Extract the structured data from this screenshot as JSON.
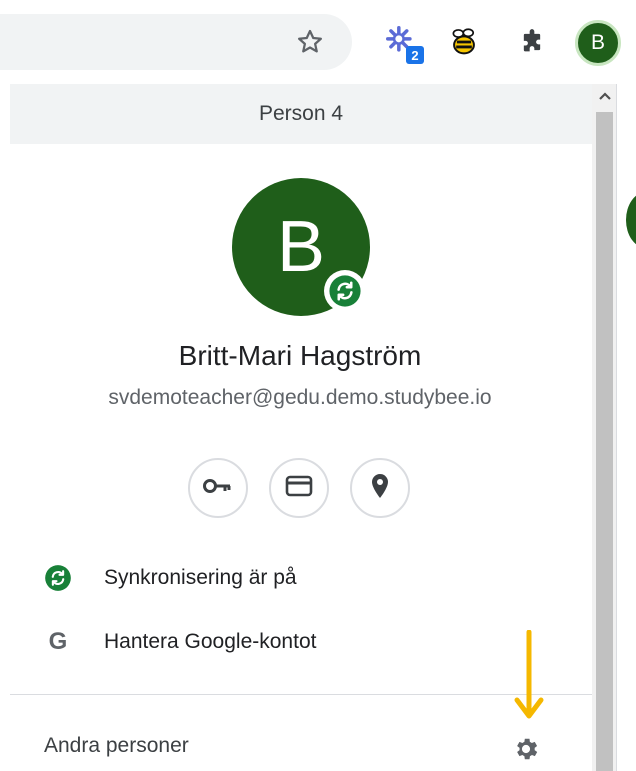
{
  "toolbar": {
    "extensions": [
      {
        "name": "puzzle-sparkle-extension",
        "badge": "2"
      },
      {
        "name": "bee-extension"
      },
      {
        "name": "extensions-puzzle"
      }
    ],
    "profile_initial": "B"
  },
  "profile_menu": {
    "header": "Person 4",
    "avatar_initial": "B",
    "name": "Britt-Mari Hagström",
    "email": "svdemoteacher@gedu.demo.studybee.io",
    "actions": [
      {
        "icon": "key-icon"
      },
      {
        "icon": "credit-card-icon"
      },
      {
        "icon": "location-pin-icon"
      }
    ],
    "rows": [
      {
        "icon": "sync-icon",
        "label": "Synkronisering är på"
      },
      {
        "icon": "google-g-icon",
        "label": "Hantera Google-kontot",
        "glyph": "G"
      }
    ],
    "other_people": "Andra personer"
  },
  "colors": {
    "avatar_green": "#1f5e1a",
    "sync_green": "#188038",
    "annotation_arrow": "#f5b800",
    "badge_blue": "#1a73e8"
  }
}
